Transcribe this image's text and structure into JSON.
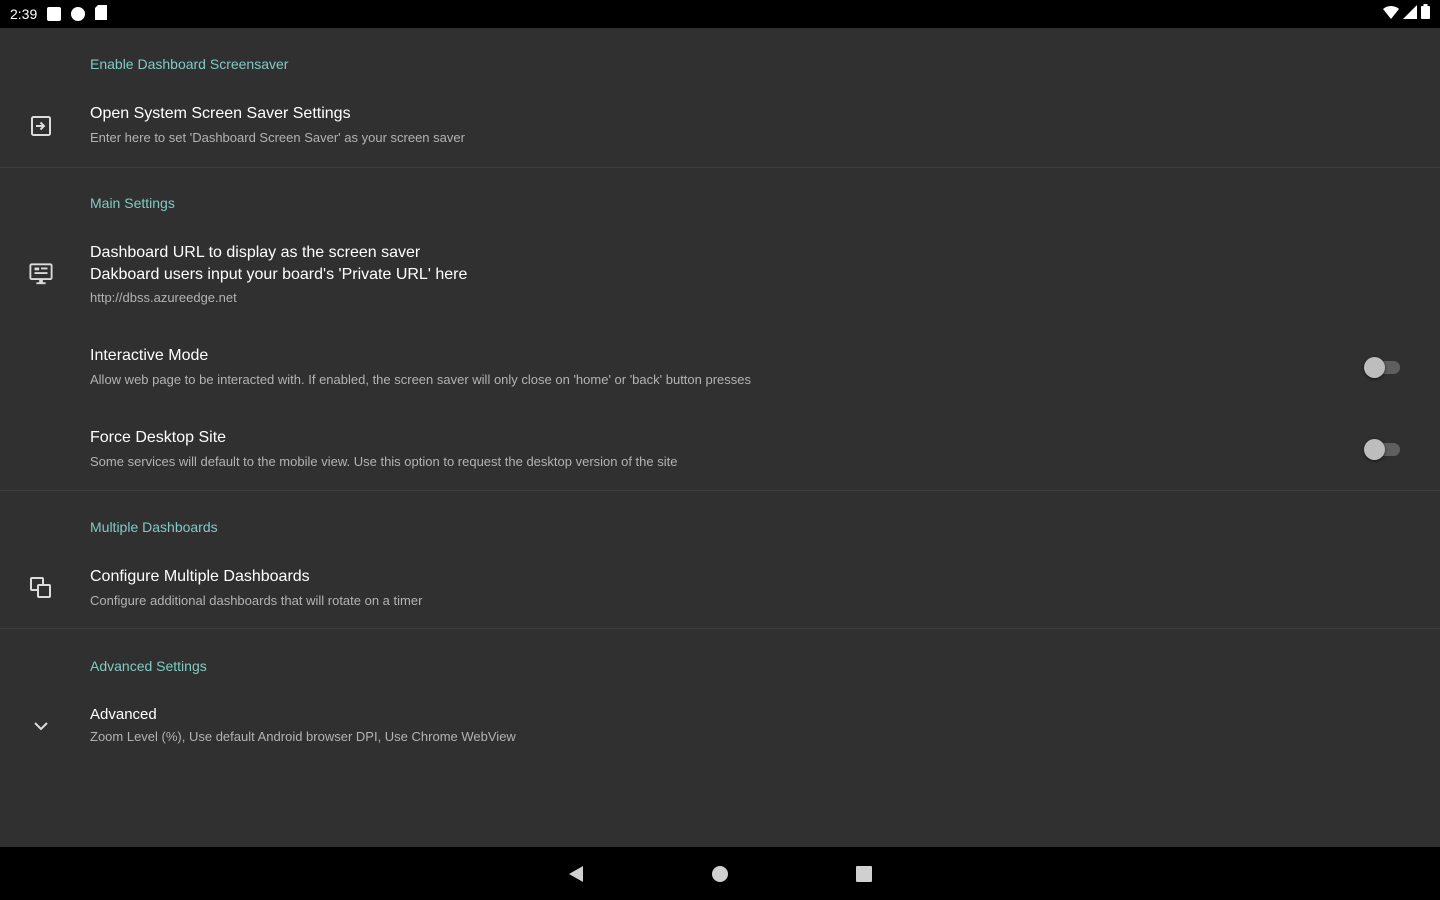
{
  "status_bar": {
    "time": "2:39",
    "left_icons": [
      "notification-icon",
      "p-icon",
      "sd-card-icon"
    ],
    "right_icons": [
      "wifi-icon",
      "signal-icon",
      "battery-icon"
    ]
  },
  "sections": {
    "enable": {
      "header": "Enable Dashboard Screensaver",
      "item": {
        "title": "Open System Screen Saver Settings",
        "summary": "Enter here to set 'Dashboard Screen Saver' as your screen saver",
        "icon": "open-in-icon"
      }
    },
    "main": {
      "header": "Main Settings",
      "url": {
        "title_line1": "Dashboard URL to display as the screen saver",
        "title_line2": "Dakboard users input your board's 'Private URL' here",
        "summary": "http://dbss.azureedge.net",
        "icon": "monitor-icon"
      },
      "interactive": {
        "title": "Interactive Mode",
        "summary": "Allow web page to be interacted with. If enabled, the screen saver will only close on 'home' or 'back' button presses",
        "checked": false
      },
      "desktop": {
        "title": "Force Desktop Site",
        "summary": "Some services will default to the mobile view. Use this option to request the desktop version of the site",
        "checked": false
      }
    },
    "multiple": {
      "header": "Multiple Dashboards",
      "item": {
        "title": "Configure Multiple Dashboards",
        "summary": "Configure additional dashboards that will rotate on a timer",
        "icon": "copy-icon"
      }
    },
    "advanced": {
      "header": "Advanced Settings",
      "item": {
        "title": "Advanced",
        "summary": "Zoom Level (%), Use default Android browser DPI, Use Chrome WebView",
        "icon": "chevron-down-icon"
      }
    }
  },
  "colors": {
    "background": "#303030",
    "accent": "#80cbc4",
    "text_primary": "#ffffff",
    "text_secondary": "#b3b3b3",
    "bars": "#000000"
  }
}
